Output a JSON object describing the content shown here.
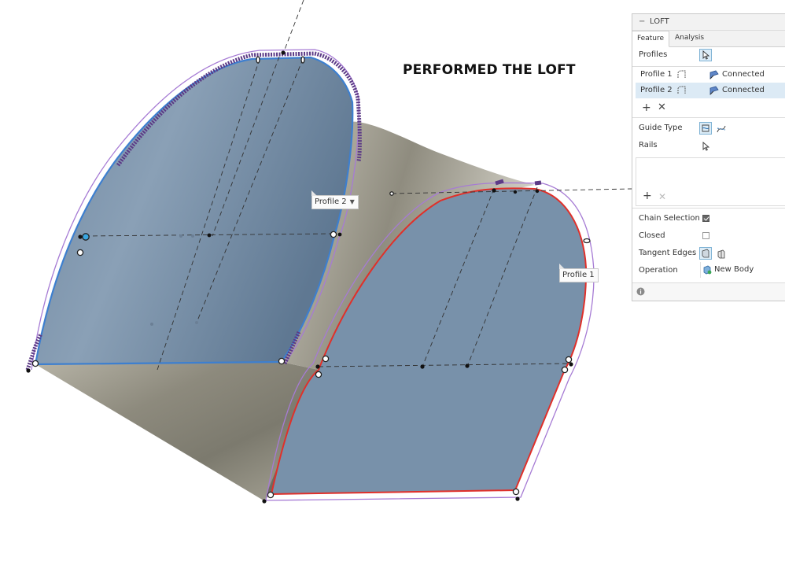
{
  "annotation_text": "PERFORMED THE LOFT",
  "viewport_tags": {
    "profile2": "Profile 2",
    "profile1": "Profile 1"
  },
  "panel": {
    "title": "LOFT",
    "tabs": [
      "Feature",
      "Analysis"
    ],
    "profiles_label": "Profiles",
    "profiles": [
      {
        "name": "Profile 1",
        "status": "Connected"
      },
      {
        "name": "Profile 2",
        "status": "Connected"
      }
    ],
    "guide_type_label": "Guide Type",
    "rails_label": "Rails",
    "chain_selection_label": "Chain Selection",
    "chain_selection_checked": true,
    "closed_label": "Closed",
    "closed_checked": false,
    "tangent_edges_label": "Tangent Edges",
    "operation_label": "Operation",
    "operation_value": "New Body"
  },
  "icons": {
    "collapse": "minus-icon",
    "select": "pointer-select-icon",
    "add": "plus-icon",
    "remove": "x-icon",
    "info": "info-icon"
  },
  "colors": {
    "left_face": "#6f87a0",
    "right_face": "#7a93ab",
    "side_surface": "#8f8c80",
    "profile1_edge": "#e0302a",
    "profile2_edge": "#3d7fcf",
    "guide_outline": "#a67bd4",
    "point_cluster": "#5c3a86",
    "panel_highlight": "#dceaf5"
  }
}
